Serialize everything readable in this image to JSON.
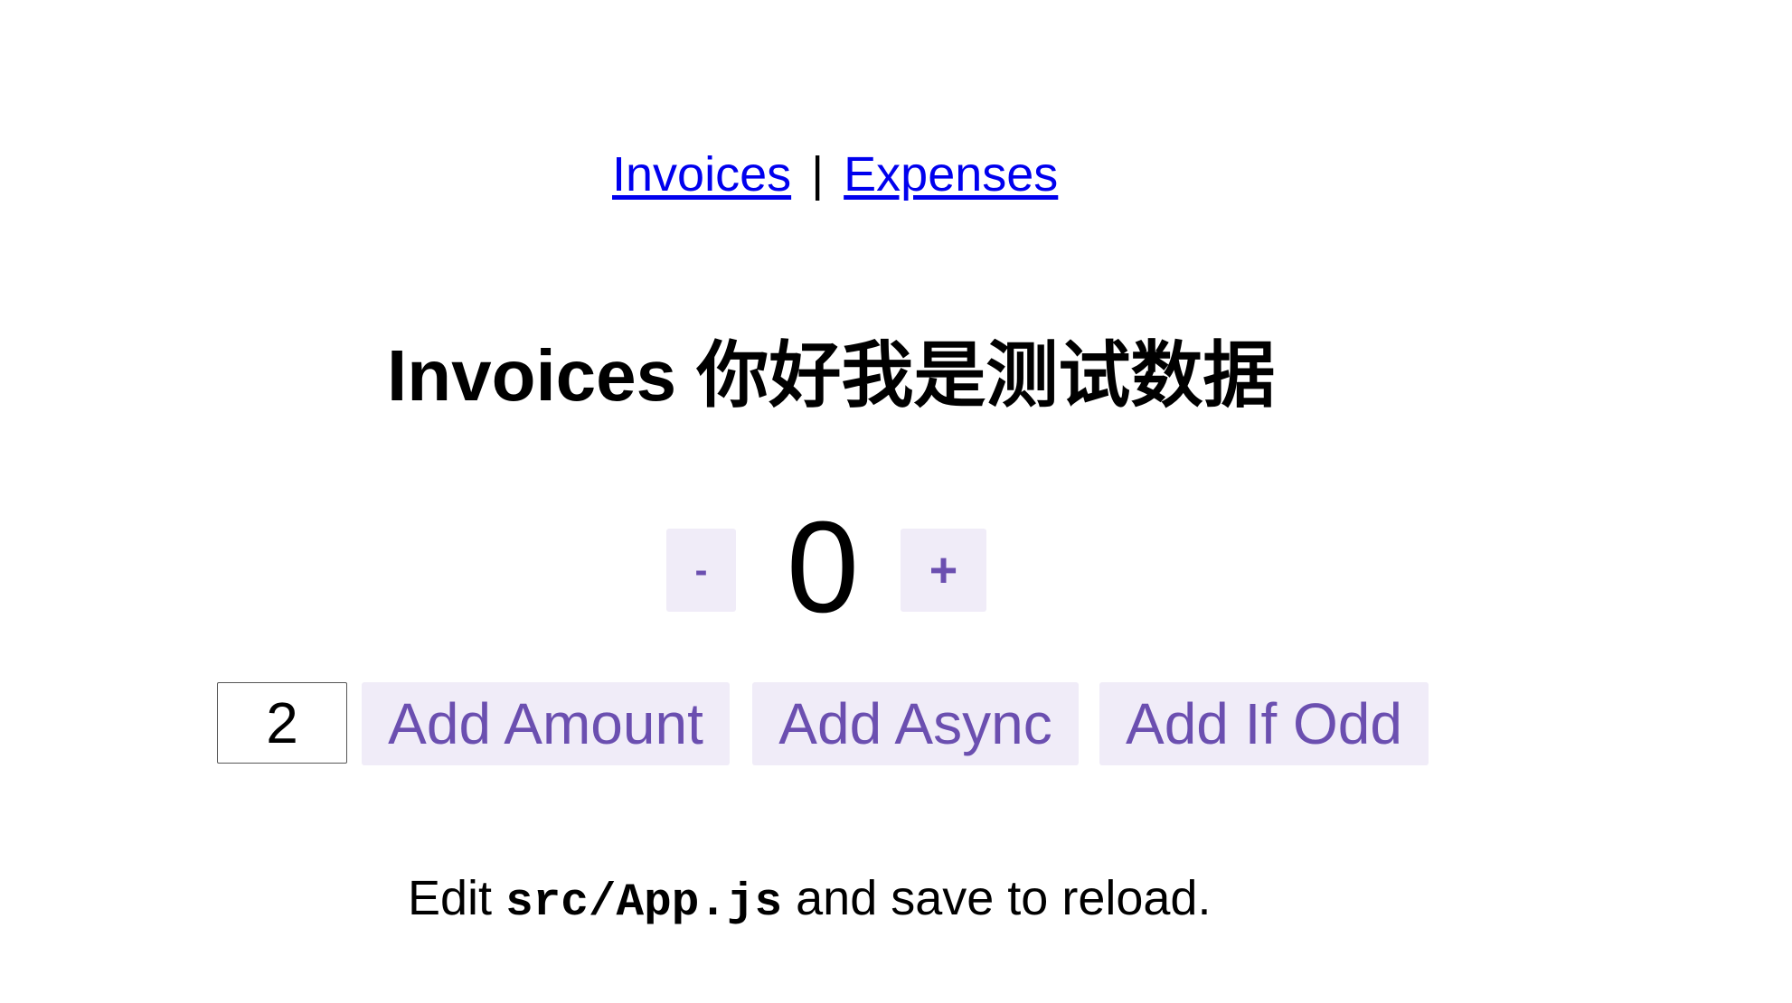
{
  "nav": {
    "invoices_link": "Invoices",
    "separator": "|",
    "expenses_link": "Expenses"
  },
  "heading": {
    "title": "Invoices 你好我是测试数据"
  },
  "counter": {
    "decrement_label": "-",
    "value": "0",
    "increment_label": "+"
  },
  "controls": {
    "amount_value": "2",
    "add_amount_label": "Add Amount",
    "add_async_label": "Add Async",
    "add_if_odd_label": "Add If Odd"
  },
  "hint": {
    "prefix": "Edit ",
    "code": "src/App.js",
    "suffix": " and save to reload."
  },
  "colors": {
    "link": "#0000ee",
    "button_background": "#f0ecf8",
    "button_text": "#6b4fb0",
    "text": "#000000",
    "background": "#ffffff"
  }
}
